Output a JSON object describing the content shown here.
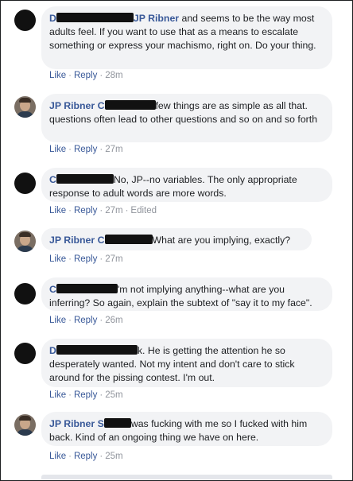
{
  "comments": [
    {
      "author_prefix": "D",
      "author_suffix": "JP Ribner",
      "text": "and seems to be the way most adults feel. If you want to use that as a means to escalate something or express your machismo, right on. Do your thing.",
      "actions": {
        "like": "Like",
        "reply": "Reply",
        "time": "28m"
      }
    },
    {
      "author": "JP Ribner",
      "mention_prefix": "C",
      "text": "few things are as simple as all that. questions often lead to other questions and so on and so forth",
      "actions": {
        "like": "Like",
        "reply": "Reply",
        "time": "27m"
      }
    },
    {
      "author_prefix": "C",
      "text": "No, JP--no variables. The only appropriate response to adult words are more words.",
      "actions": {
        "like": "Like",
        "reply": "Reply",
        "time": "27m",
        "edited": "Edited"
      }
    },
    {
      "author": "JP Ribner",
      "mention_prefix": "C",
      "text": "What are you implying, exactly?",
      "actions": {
        "like": "Like",
        "reply": "Reply",
        "time": "27m"
      }
    },
    {
      "author_prefix": "C",
      "text": "'m not implying anything--what are you inferring? So again, explain the subtext of \"say it to my face\".",
      "actions": {
        "like": "Like",
        "reply": "Reply",
        "time": "26m"
      }
    },
    {
      "author_prefix": "D",
      "text": "k. He is getting the attention he so desperately wanted. Not my intent and don't care to stick around for the pissing contest. I'm out.",
      "actions": {
        "like": "Like",
        "reply": "Reply",
        "time": "25m"
      }
    },
    {
      "author": "JP Ribner",
      "mention_prefix": "S",
      "text": "was fucking with me so I fucked with him back. Kind of an ongoing thing we have on here.",
      "actions": {
        "like": "Like",
        "reply": "Reply",
        "time": "25m"
      }
    }
  ],
  "colors": {
    "link": "#385898",
    "bubble": "#f2f3f5",
    "meta": "#616770"
  }
}
